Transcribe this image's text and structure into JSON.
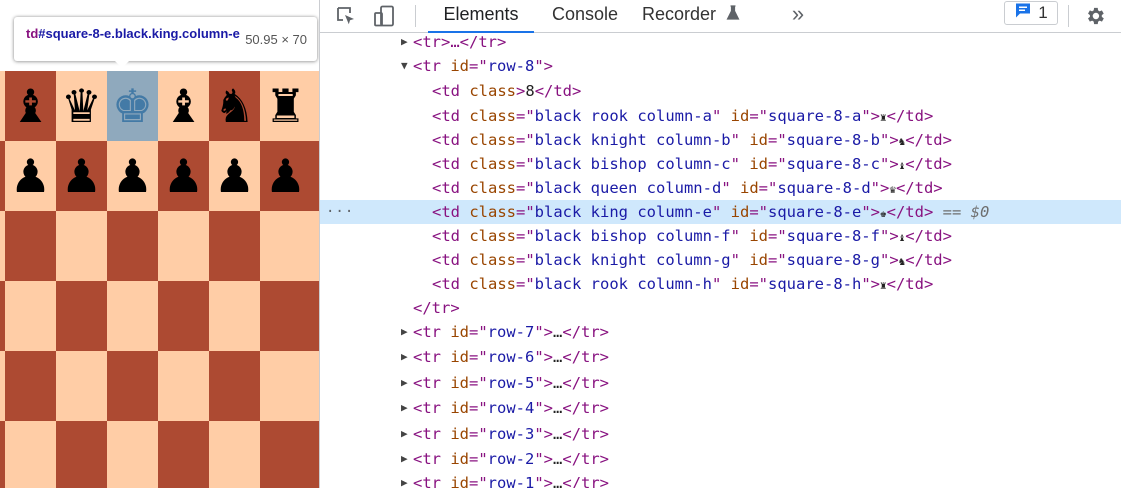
{
  "tooltip": {
    "tag": "td",
    "selector": "#square-8-e.black.king.column-e",
    "size": "50.95 × 70"
  },
  "board": {
    "highlight_color": "#8fa9bd",
    "dark_color": "#ad4a32",
    "light_color": "#ffcda6",
    "rank8": [
      "♝",
      "♛",
      "♚",
      "♝",
      "♞",
      "♜"
    ],
    "rank7": [
      "♟",
      "♟",
      "♟",
      "♟",
      "♟",
      "♟"
    ]
  },
  "devtools": {
    "tabs": [
      "Elements",
      "Console",
      "Recorder"
    ],
    "active_tab": "Elements",
    "more_tabs": "»",
    "issues_count": "1",
    "accent_color": "#1a73e8",
    "tree": [
      {
        "arrow": "▶",
        "text": "<tr>…</tr>"
      },
      {
        "arrow": "▼",
        "open": "tr",
        "id": "row-8"
      },
      {
        "td_class_only": "8"
      },
      {
        "cls": "black rook column-a",
        "id": "square-8-a",
        "glyph": "♜"
      },
      {
        "cls": "black knight column-b",
        "id": "square-8-b",
        "glyph": "♞"
      },
      {
        "cls": "black bishop column-c",
        "id": "square-8-c",
        "glyph": "♝"
      },
      {
        "cls": "black queen column-d",
        "id": "square-8-d",
        "glyph": "♛"
      },
      {
        "cls": "black king column-e",
        "id": "square-8-e",
        "glyph": "♚",
        "selected": true,
        "marker": "== $0"
      },
      {
        "cls": "black bishop column-f",
        "id": "square-8-f",
        "glyph": "♝"
      },
      {
        "cls": "black knight column-g",
        "id": "square-8-g",
        "glyph": "♞"
      },
      {
        "cls": "black rook column-h",
        "id": "square-8-h",
        "glyph": "♜"
      },
      {
        "close": "</tr>"
      },
      {
        "arrow": "▶",
        "row": "row-7"
      },
      {
        "arrow": "▶",
        "row": "row-6"
      },
      {
        "arrow": "▶",
        "row": "row-5"
      },
      {
        "arrow": "▶",
        "row": "row-4"
      },
      {
        "arrow": "▶",
        "row": "row-3"
      },
      {
        "arrow": "▶",
        "row": "row-2"
      },
      {
        "arrow": "▶",
        "row": "row-1"
      }
    ]
  }
}
